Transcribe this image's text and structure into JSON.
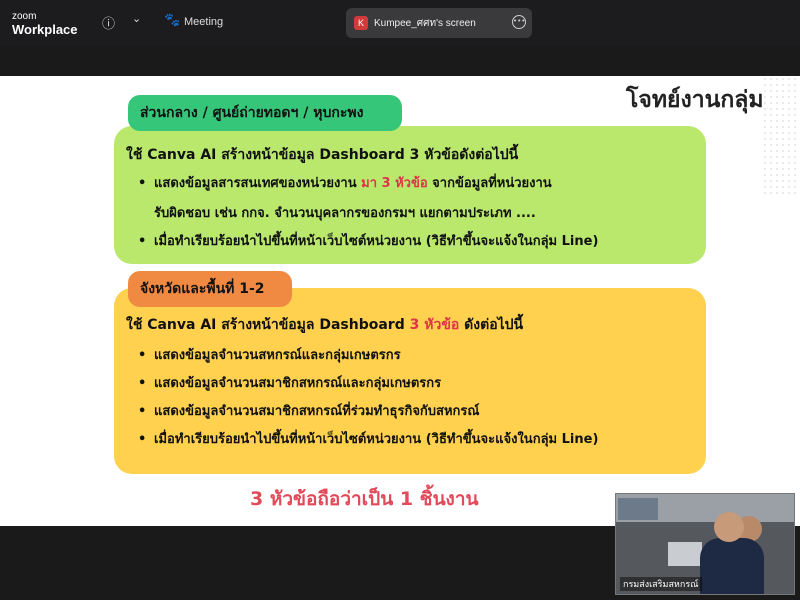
{
  "app": {
    "logo_line1": "zoom",
    "logo_line2": "Workplace"
  },
  "toolbar": {
    "meeting_label": "Meeting"
  },
  "share": {
    "avatar_letter": "K",
    "label": "Kumpee_ศศท's screen"
  },
  "slide": {
    "title": "โจทย์งานกลุ่ม",
    "section1": {
      "tag": "ส่วนกลาง / ศูนย์ถ่ายทอดฯ / หุบกะพง",
      "intro": "ใช้ Canva AI สร้างหน้าข้อมูล Dashboard 3 หัวข้อดังต่อไปนี้",
      "bullet1_part1": "แสดงข้อมูลสารสนเทศของหน่วยงาน ",
      "bullet1_highlight": "มา 3 หัวข้อ",
      "bullet1_part2": " จากข้อมูลที่หน่วยงาน",
      "bullet1_cont": "รับผิดชอบ เช่น กกจ. จำนวนบุคลากรของกรมฯ แยกตามประเภท ....",
      "bullet2": "เมื่อทำเรียบร้อยนำไปขึ้นที่หน้าเว็บไซต์หน่วยงาน (วิธีทำขึ้นจะแจ้งในกลุ่ม Line)"
    },
    "section2": {
      "tag": "จังหวัดและพื้นที่ 1-2",
      "intro_part1": "ใช้ Canva AI สร้างหน้าข้อมูล Dashboard ",
      "intro_highlight": "3 หัวข้อ",
      "intro_part2": " ดังต่อไปนี้",
      "bullets": [
        "แสดงข้อมูลจำนวนสหกรณ์และกลุ่มเกษตรกร",
        "แสดงข้อมูลจำนวนสมาชิกสหกรณ์และกลุ่มเกษตรกร",
        "แสดงข้อมูลจำนวนสมาชิกสหกรณ์ที่ร่วมทำธุรกิจกับสหกรณ์",
        "เมื่อทำเรียบร้อยนำไปขึ้นที่หน้าเว็บไซต์หน่วยงาน (วิธีทำขึ้นจะแจ้งในกลุ่ม  Line)"
      ]
    },
    "footer": "3 หัวข้อถือว่าเป็น 1 ชิ้นงาน"
  },
  "video": {
    "participant_name": "กรมส่งเสริมสหกรณ์"
  },
  "colors": {
    "green_box": "#b9e86d",
    "green_tag": "#35c67a",
    "orange_tag": "#f08a43",
    "yellow_box": "#ffd14f",
    "highlight": "#e0334a"
  }
}
